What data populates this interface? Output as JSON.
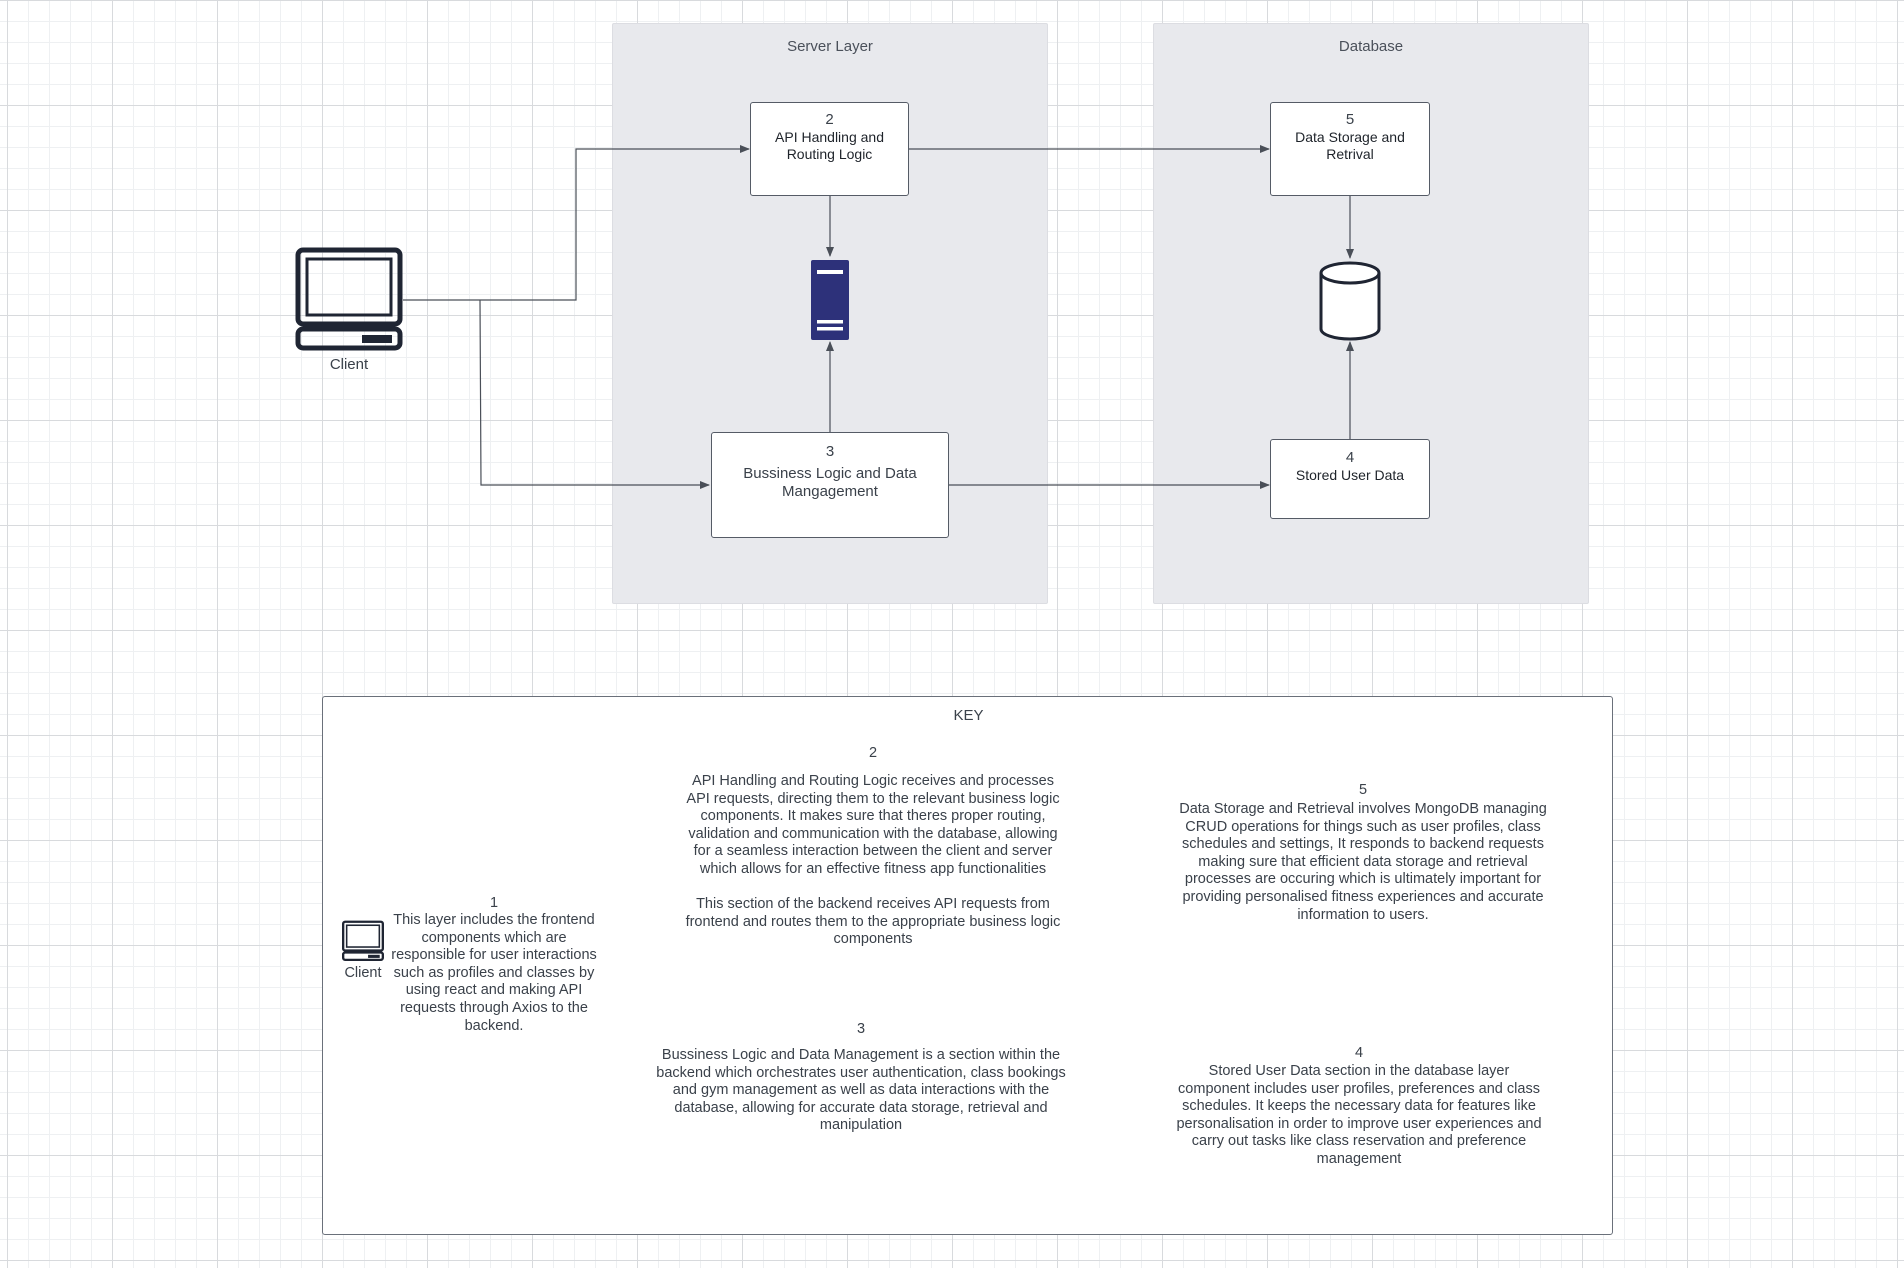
{
  "lanes": {
    "server": {
      "title": "Server Layer"
    },
    "database": {
      "title": "Database"
    }
  },
  "nodes": {
    "client": {
      "label": "Client",
      "icon": "laptop-icon"
    },
    "api": {
      "number": "2",
      "label": "API Handling and\nRouting Logic"
    },
    "server_icon": {
      "icon": "server-icon",
      "color": "#2d317a"
    },
    "business": {
      "number": "3",
      "label": "Bussiness Logic and Data\nMangagement"
    },
    "storage": {
      "number": "5",
      "label": "Data Storage and\nRetrival"
    },
    "db_icon": {
      "icon": "database-cylinder-icon"
    },
    "stored": {
      "number": "4",
      "label": "Stored User Data"
    }
  },
  "key": {
    "title": "KEY",
    "client": {
      "icon": "laptop-icon",
      "label": "Client",
      "number": "1",
      "text": "This layer includes the frontend\ncomponents which are\nresponsible for user interactions\nsuch as profiles and classes by\nusing react and making API\nrequests through Axios to the\nbackend."
    },
    "api": {
      "number": "2",
      "text": "API Handling and Routing Logic receives and processes\nAPI requests, directing them to the relevant business logic\ncomponents. It makes sure that theres proper routing,\nvalidation and communication with the database, allowing\nfor a seamless interaction between the client and server\nwhich allows for an effective fitness app functionalities\n\nThis section of the backend receives API requests from\nfrontend and routes them to the appropriate business logic\ncomponents"
    },
    "business": {
      "number": "3",
      "text": "Bussiness Logic and Data Management is a section within the\nbackend which orchestrates user authentication, class bookings\nand gym management as well as data interactions with the\ndatabase, allowing for accurate data storage, retrieval and\nmanipulation"
    },
    "storage": {
      "number": "5",
      "text": "Data Storage and Retrieval involves MongoDB managing\nCRUD operations for things such as user profiles, class\nschedules and settings, It responds to backend requests\nmaking sure that efficient data storage and retrieval\nprocesses are occuring which is ultimately important for\nproviding personalised fitness experiences and accurate\ninformation to users."
    },
    "stored": {
      "number": "4",
      "text": "Stored User Data section in the database layer\ncomponent includes user profiles, preferences and class\nschedules. It keeps the necessary data for features like\npersonalisation in order to improve user experiences and\ncarry out tasks like class reservation and preference\nmanagement"
    }
  },
  "colors": {
    "lane_fill": "#e8e9ed",
    "wire": "#4a4f58",
    "server_icon": "#2d317a",
    "icon_stroke": "#1f2533"
  }
}
